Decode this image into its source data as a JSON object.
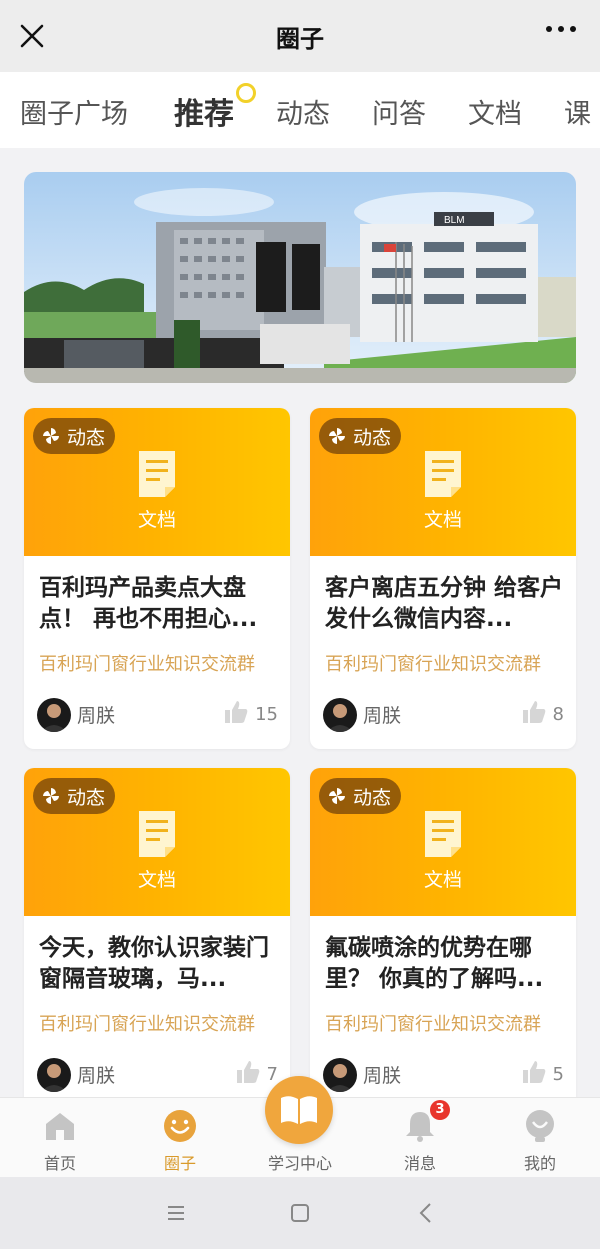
{
  "header": {
    "title": "圈子"
  },
  "tabs": [
    {
      "label": "圈子广场",
      "active": false
    },
    {
      "label": "推荐",
      "active": true
    },
    {
      "label": "动态",
      "active": false
    },
    {
      "label": "问答",
      "active": false
    },
    {
      "label": "文档",
      "active": false
    },
    {
      "label": "课",
      "active": false
    }
  ],
  "banner": {
    "sign_text": "BLM"
  },
  "cards": [
    {
      "badge": "动态",
      "type_label": "文档",
      "title": "百利玛产品卖点大盘点！ 再也不用担心...",
      "group": "百利玛门窗行业知识交流群",
      "author": "周朕",
      "likes": "15"
    },
    {
      "badge": "动态",
      "type_label": "文档",
      "title": "客户离店五分钟 给客户发什么微信内容...",
      "group": "百利玛门窗行业知识交流群",
      "author": "周朕",
      "likes": "8"
    },
    {
      "badge": "动态",
      "type_label": "文档",
      "title": "今天，教你认识家装门窗隔音玻璃，马...",
      "group": "百利玛门窗行业知识交流群",
      "author": "周朕",
      "likes": "7"
    },
    {
      "badge": "动态",
      "type_label": "文档",
      "title": "氟碳喷涂的优势在哪里？ 你真的了解吗...",
      "group": "百利玛门窗行业知识交流群",
      "author": "周朕",
      "likes": "5"
    }
  ],
  "bottom_nav": {
    "items": [
      {
        "label": "首页",
        "icon": "home-icon"
      },
      {
        "label": "圈子",
        "icon": "smile-icon",
        "active": true
      },
      {
        "label": "学习中心",
        "icon": "book-icon"
      },
      {
        "label": "消息",
        "icon": "bell-icon",
        "badge": "3"
      },
      {
        "label": "我的",
        "icon": "user-icon"
      }
    ]
  },
  "colors": {
    "accent": "#f0a63d",
    "card_gradient_start": "#ffa20a",
    "card_gradient_end": "#ffc600",
    "group_text": "#d8a455",
    "badge_red": "#e8352c"
  }
}
